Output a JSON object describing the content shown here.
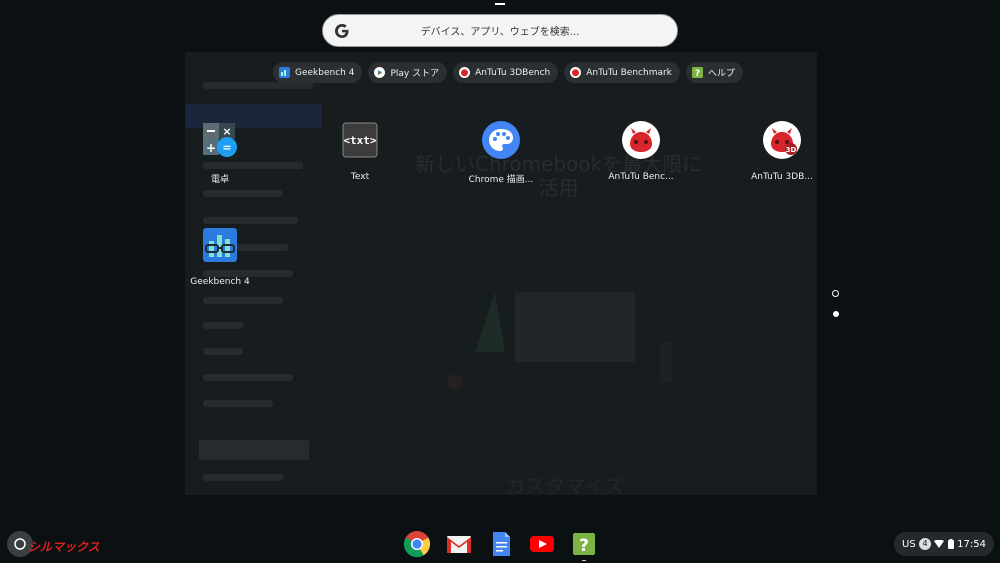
{
  "search": {
    "placeholder": "デバイス、アプリ、ウェブを検索..."
  },
  "suggestions": [
    {
      "label": "Geekbench 4",
      "icon": "geekbench-icon"
    },
    {
      "label": "Play ストア",
      "icon": "play-store-icon"
    },
    {
      "label": "AnTuTu 3DBench",
      "icon": "antutu-3d-icon"
    },
    {
      "label": "AnTuTu Benchmark",
      "icon": "antutu-icon"
    },
    {
      "label": "ヘルプ",
      "icon": "help-icon"
    }
  ],
  "apps": [
    {
      "label": "電卓",
      "icon": "calculator-icon"
    },
    {
      "label": "Text",
      "icon": "text-editor-icon"
    },
    {
      "label": "Chrome 描画...",
      "icon": "chrome-canvas-icon"
    },
    {
      "label": "AnTuTu Benc...",
      "icon": "antutu-icon"
    },
    {
      "label": "AnTuTu 3DB...",
      "icon": "antutu-3d-icon"
    },
    {
      "label": "Geekbench 4",
      "icon": "geekbench-icon"
    }
  ],
  "background_window": {
    "title": "新しいChromebookを最大限に\n活用",
    "bottom_text": "カスタマイズ"
  },
  "pagination": {
    "pages": 2,
    "current": 1
  },
  "shelf": {
    "apps": [
      "chrome-icon",
      "gmail-icon",
      "docs-icon",
      "youtube-icon",
      "help-icon"
    ],
    "watermark": "シルマックス"
  },
  "tray": {
    "ime": "US",
    "notifications": "4",
    "time": "17:54"
  },
  "colors": {
    "accent": "#1a73e8",
    "antutu": "#d6262c",
    "help": "#7cb342"
  }
}
